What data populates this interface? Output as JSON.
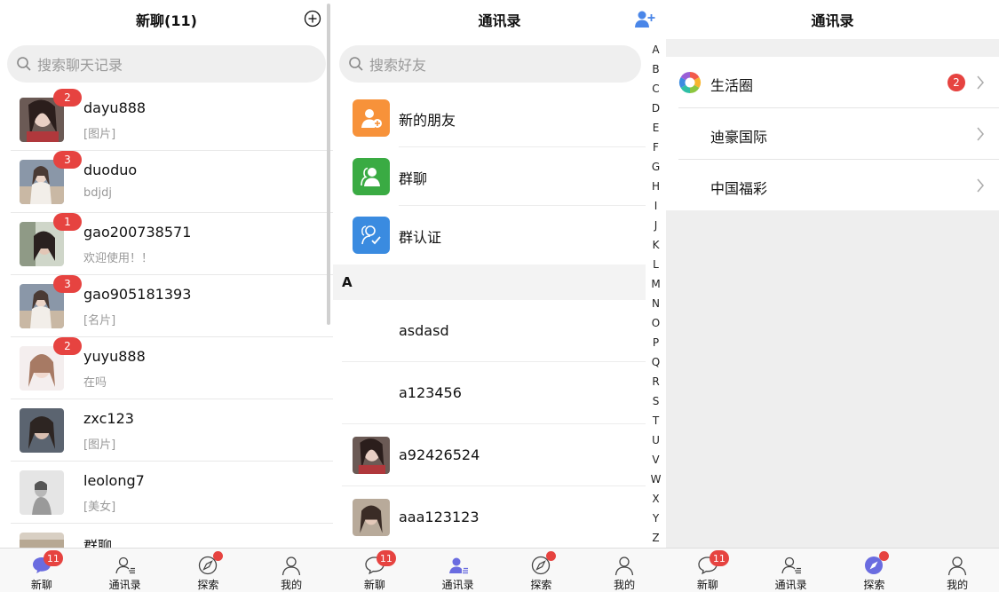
{
  "chats_screen": {
    "title": "新聊(11)",
    "search_placeholder": "搜索聊天记录",
    "items": [
      {
        "name": "dayu888",
        "preview": "[图片]",
        "badge": "2"
      },
      {
        "name": "duoduo",
        "preview": "bdjdj",
        "badge": "3"
      },
      {
        "name": "gao200738571",
        "preview": "欢迎使用！！",
        "badge": "1"
      },
      {
        "name": "gao905181393",
        "preview": "[名片]",
        "badge": "3"
      },
      {
        "name": "yuyu888",
        "preview": "在吗",
        "badge": "2"
      },
      {
        "name": "zxc123",
        "preview": "[图片]",
        "badge": ""
      },
      {
        "name": "leolong7",
        "preview": "[美女]",
        "badge": ""
      },
      {
        "name": "群聊",
        "preview": "",
        "badge": ""
      }
    ]
  },
  "contacts_screen": {
    "title": "通讯录",
    "search_placeholder": "搜索好友",
    "functions": [
      {
        "label": "新的朋友",
        "color": "#f7923a"
      },
      {
        "label": "群聊",
        "color": "#3aab43"
      },
      {
        "label": "群认证",
        "color": "#3a8be0"
      }
    ],
    "section": "A",
    "contacts": [
      {
        "name": "asdasd"
      },
      {
        "name": "a123456"
      },
      {
        "name": "a92426524"
      },
      {
        "name": "aaa123123"
      }
    ],
    "alphabet": [
      "A",
      "B",
      "C",
      "D",
      "E",
      "F",
      "G",
      "H",
      "I",
      "J",
      "K",
      "L",
      "M",
      "N",
      "O",
      "P",
      "Q",
      "R",
      "S",
      "T",
      "U",
      "V",
      "W",
      "X",
      "Y",
      "Z"
    ]
  },
  "discover_screen": {
    "title": "通讯录",
    "items": [
      {
        "label": "生活圈",
        "badge": "2"
      },
      {
        "label": "迪豪国际",
        "badge": ""
      },
      {
        "label": "中国福彩",
        "badge": ""
      }
    ]
  },
  "tabbar": {
    "tabs": [
      {
        "label": "新聊",
        "badge": "11"
      },
      {
        "label": "通讯录"
      },
      {
        "label": "探索"
      },
      {
        "label": "我的"
      }
    ],
    "active_color": "#6a6ce0",
    "badge_color": "#e64340"
  }
}
